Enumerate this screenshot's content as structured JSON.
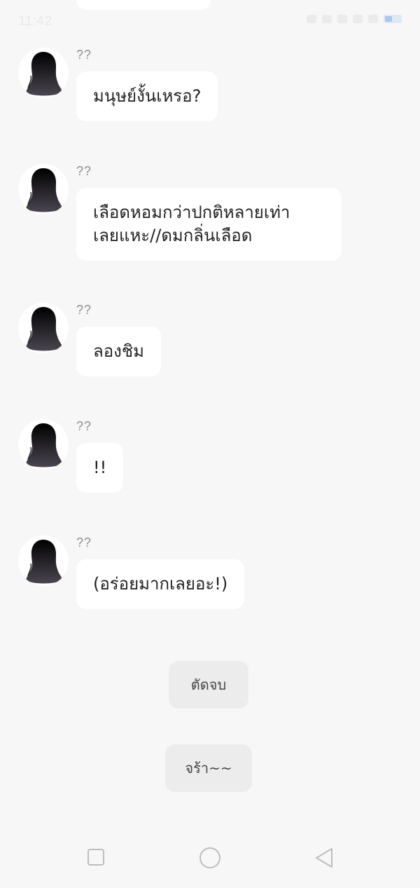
{
  "status_bar": {
    "time": "11:42"
  },
  "messages": [
    {
      "sender": "??",
      "text": "มนุษย์งั้นเหรอ?"
    },
    {
      "sender": "??",
      "text": "เลือดหอมกว่าปกติหลายเท่า\nเลยแหะ//ดมกลิ่นเลือด"
    },
    {
      "sender": "??",
      "text": "ลองชิม"
    },
    {
      "sender": "??",
      "text": "!!"
    },
    {
      "sender": "??",
      "text": "(อร่อยมากเลยอะ!)"
    }
  ],
  "choices": [
    {
      "label": "ตัดจบ"
    },
    {
      "label": "จร้า~~"
    }
  ],
  "navigation": {
    "icons": [
      "recent-apps-icon",
      "home-icon",
      "back-icon"
    ]
  },
  "colors": {
    "background": "#f7f7f7",
    "bubble": "#ffffff",
    "choice_button": "#ececec",
    "sender_text": "#8f8f8f"
  }
}
